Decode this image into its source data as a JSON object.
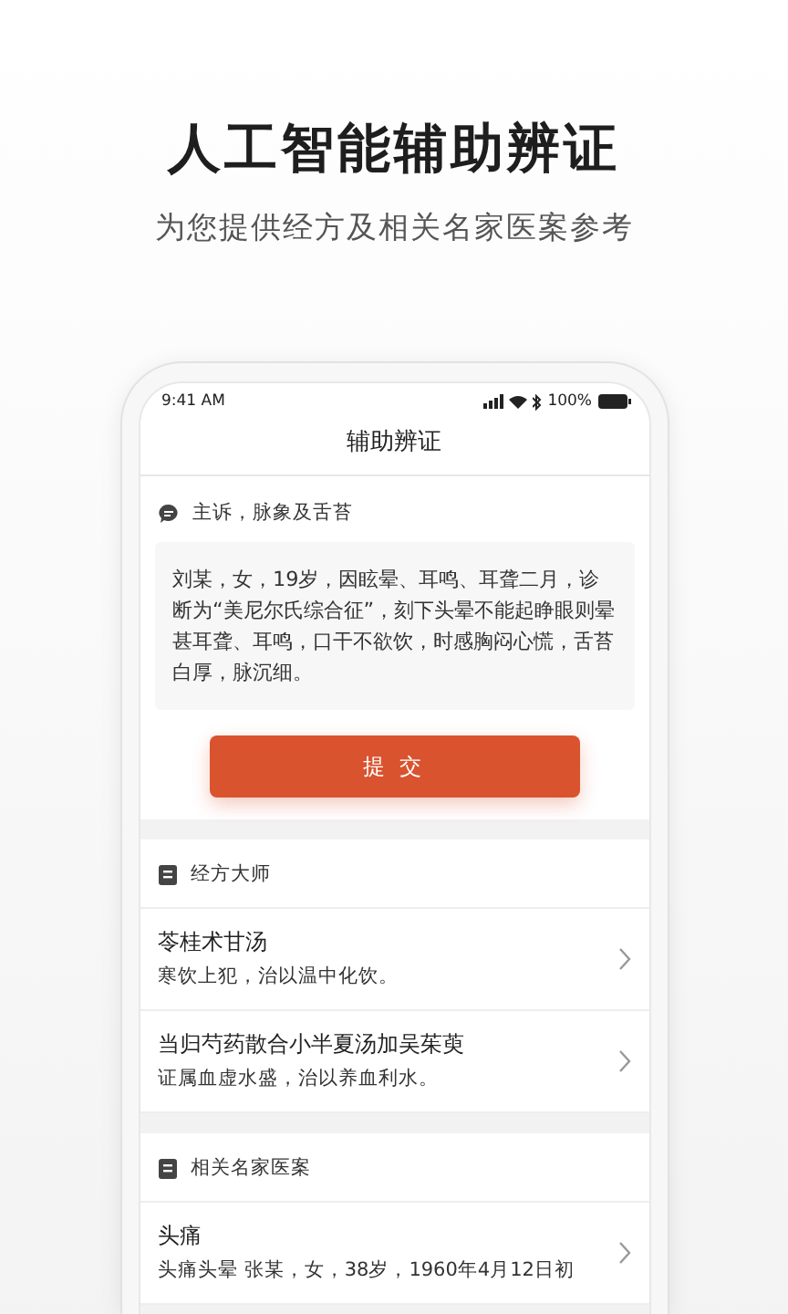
{
  "headline": "人工智能辅助辨证",
  "subheadline": "为您提供经方及相关名家医案参考",
  "status_bar": {
    "time": "9:41 AM",
    "battery": "100%"
  },
  "screen_title": "辅助辨证",
  "complaint": {
    "label": "主诉，脉象及舌苔",
    "text": "刘某，女，19岁，因眩晕、耳鸣、耳聋二月，诊断为“美尼尔氏综合征”，刻下头晕不能起睁眼则晕甚耳聋、耳鸣，口干不欲饮，时感胸闷心慌，舌苔白厚，脉沉细。"
  },
  "submit_button": "提 交",
  "sections": [
    {
      "title": "经方大师",
      "items": [
        {
          "title": "苓桂术甘汤",
          "summary": "寒饮上犯，治以温中化饮。"
        },
        {
          "title": "当归芍药散合小半夏汤加吴茱萸",
          "summary": "证属血虚水盛，治以养血利水。"
        }
      ]
    },
    {
      "title": "相关名家医案",
      "items": [
        {
          "title": "头痛",
          "summary": "头痛头晕 张某，女，38岁，1960年4月12日初"
        }
      ]
    }
  ]
}
